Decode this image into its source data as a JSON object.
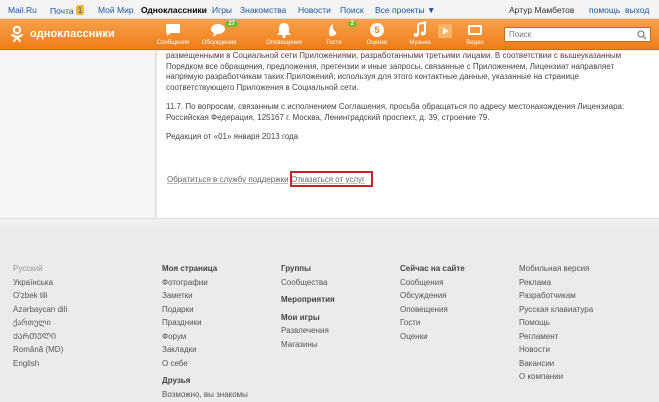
{
  "topbar": {
    "mailru": "Mail.Ru",
    "pochta": "Почта",
    "pochta_count": "1",
    "moimir": "Мой Мир",
    "ok": "Одноклассники",
    "igry": "Игры",
    "znakomstva": "Знакомства",
    "novosti": "Новости",
    "poisk": "Поиск",
    "vse": "Все проекты",
    "user": "Артур Мамбетов",
    "help": "помощь",
    "exit": "выход"
  },
  "header": {
    "logo_text": "одноклассники",
    "nav": [
      {
        "label": "Сообщения",
        "icon": "messages-icon"
      },
      {
        "label": "Обсуждения",
        "icon": "discussions-icon",
        "badge": "27"
      },
      {
        "label": "Оповещения",
        "icon": "bell-icon"
      },
      {
        "label": "Гости",
        "icon": "guests-icon",
        "badge": "2"
      },
      {
        "label": "Оценки",
        "icon": "ratings-icon"
      },
      {
        "label": "Музыка",
        "icon": "music-icon"
      },
      {
        "label": "Видео",
        "icon": "video-icon"
      }
    ],
    "search_placeholder": "Поиск"
  },
  "content": {
    "p1": "размещенными в Социальной сети Приложениями, разработанными третьими лицами. В соответствии с вышеуказанным Порядком все обращения, предложения, претензии и иные запросы, связанные с Приложением, Лицензиат направляет напрямую разработчикам таких Приложений, используя для этого контактные данные, указанные на странице соответствующего Приложения в Социальной сети.",
    "p2": "11.7. По вопросам, связанным с исполнением Соглашения, просьба обращаться по адресу местонахождения Лицензиара: Российская Федерация, 125167 г. Москва, Ленинградский проспект, д. 39, строение 79.",
    "p3": "Редакция от «01» января 2013 года",
    "link_support": "Обратиться в службу поддержки",
    "link_refuse": "Отказаться от услуг"
  },
  "footer": {
    "languages": [
      "Русский",
      "Українська",
      "O'zbek tili",
      "Azərbaycan dili",
      "ქართული",
      "ᲥᲐᲠᲗᲣᲚᲘ",
      "Română (MD)",
      "English"
    ],
    "col_mypage": {
      "title": "Моя страница",
      "items": [
        "Фотографии",
        "Заметки",
        "Подарки",
        "Праздники",
        "Форум",
        "Закладки",
        "О себе"
      ],
      "friends_title": "Друзья",
      "friends_items": [
        "Возможно, вы знакомы"
      ]
    },
    "col_groups": {
      "title": "Группы",
      "items": [
        "Сообщества"
      ],
      "events_title": "Мероприятия",
      "games_title": "Мои игры",
      "games_items": [
        "Развлечения",
        "Магазины"
      ]
    },
    "col_now": {
      "title": "Сейчас на сайте",
      "items": [
        "Сообщения",
        "Обсуждения",
        "Оповещения",
        "Гости",
        "Оценки"
      ]
    },
    "col_misc": {
      "items": [
        "Мобильная версия",
        "Реклама",
        "Разработчикам",
        "Русская клавиатура",
        "Помощь",
        "Регламент",
        "Новости",
        "Вакансии",
        "О компании"
      ]
    }
  }
}
